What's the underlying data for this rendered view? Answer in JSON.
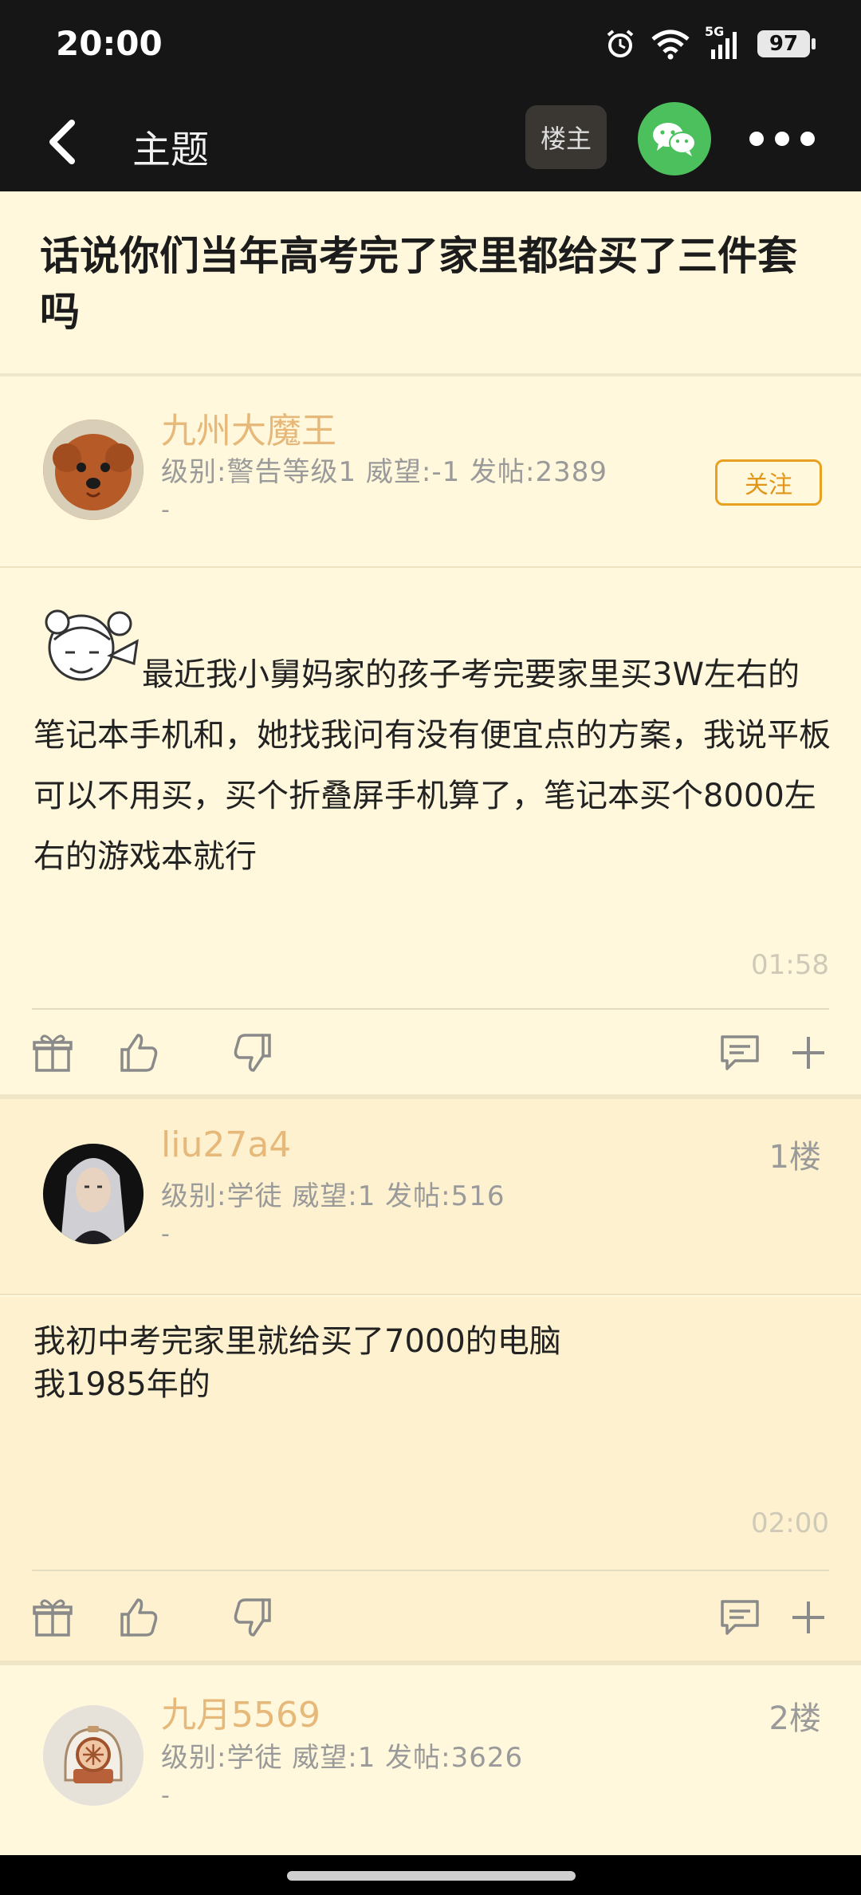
{
  "status_bar": {
    "time": "20:00",
    "battery": "97",
    "network": "5G"
  },
  "nav": {
    "title": "主题",
    "owner_label": "楼主"
  },
  "thread": {
    "title": "话说你们当年高考完了家里都给买了三件套吗"
  },
  "op": {
    "username": "九州大魔王",
    "info": "级别:警告等级1 威望:-1 发帖:2389",
    "dash": "-",
    "follow_label": "关注",
    "body": "最近我小舅妈家的孩子考完要家里买3W左右的笔记本手机和，她找我问有没有便宜点的方案，我说平板可以不用买，买个折叠屏手机算了，笔记本买个8000左右的游戏本就行",
    "time": "01:58"
  },
  "replies": [
    {
      "username": "liu27a4",
      "info": "级别:学徒 威望:1 发帖:516",
      "dash": "-",
      "floor": "1楼",
      "body_line1": "我初中考完家里就给买了7000的电脑",
      "body_line2": "我1985年的",
      "time": "02:00"
    },
    {
      "username": "九月5569",
      "info": "级别:学徒 威望:1 发帖:3626",
      "dash": "-",
      "floor": "2楼"
    }
  ],
  "colors": {
    "username": "#e6b87a",
    "background": "#fff8dc",
    "reply_background": "#fdf1cf",
    "follow": "#e8a020"
  }
}
